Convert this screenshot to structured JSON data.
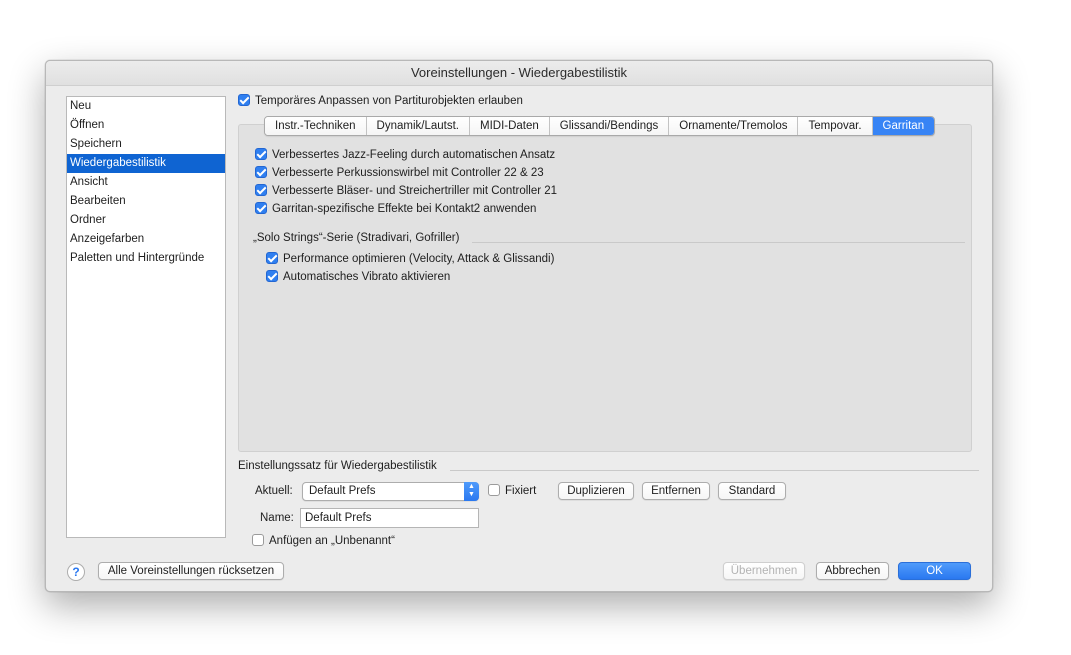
{
  "window": {
    "title": "Voreinstellungen - Wiedergabestilistik"
  },
  "sidebar": {
    "items": [
      {
        "label": "Neu",
        "selected": false
      },
      {
        "label": "Öffnen",
        "selected": false
      },
      {
        "label": "Speichern",
        "selected": false
      },
      {
        "label": "Wiedergabestilistik",
        "selected": true
      },
      {
        "label": "Ansicht",
        "selected": false
      },
      {
        "label": "Bearbeiten",
        "selected": false
      },
      {
        "label": "Ordner",
        "selected": false
      },
      {
        "label": "Anzeigefarben",
        "selected": false
      },
      {
        "label": "Paletten und Hintergründe",
        "selected": false
      }
    ]
  },
  "temp_adjust": {
    "label": "Temporäres Anpassen von Partiturobjekten erlauben",
    "checked": true
  },
  "tabs": [
    {
      "label": "Instr.-Techniken",
      "active": false
    },
    {
      "label": "Dynamik/Lautst.",
      "active": false
    },
    {
      "label": "MIDI-Daten",
      "active": false
    },
    {
      "label": "Glissandi/Bendings",
      "active": false
    },
    {
      "label": "Ornamente/Tremolos",
      "active": false
    },
    {
      "label": "Tempovar.",
      "active": false
    },
    {
      "label": "Garritan",
      "active": true
    }
  ],
  "garritan": {
    "options": [
      {
        "label": "Verbessertes Jazz-Feeling durch automatischen Ansatz",
        "checked": true
      },
      {
        "label": "Verbesserte Perkussionswirbel mit Controller 22 & 23",
        "checked": true
      },
      {
        "label": "Verbesserte Bläser- und Streichertriller mit Controller 21",
        "checked": true
      },
      {
        "label": "Garritan-spezifische Effekte bei Kontakt2 anwenden",
        "checked": true
      }
    ],
    "solo_strings_heading": "„Solo Strings“-Serie (Stradivari, Gofriller)",
    "solo_options": [
      {
        "label": "Performance optimieren (Velocity, Attack & Glissandi)",
        "checked": true
      },
      {
        "label": "Automatisches Vibrato aktivieren",
        "checked": true
      }
    ]
  },
  "preset_section": {
    "heading": "Einstellungssatz für Wiedergabestilistik",
    "current_label": "Aktuell:",
    "current_value": "Default Prefs",
    "fixed_label": "Fixiert",
    "fixed_checked": false,
    "duplicate_label": "Duplizieren",
    "remove_label": "Entfernen",
    "standard_label": "Standard",
    "name_label": "Name:",
    "name_value": "Default Prefs",
    "append_label": "Anfügen an „Unbenannt“",
    "append_checked": false
  },
  "footer": {
    "help_symbol": "?",
    "reset_all_label": "Alle Voreinstellungen rücksetzen",
    "apply_label": "Übernehmen",
    "cancel_label": "Abbrechen",
    "ok_label": "OK"
  },
  "colors": {
    "accent": "#2a78f0",
    "selection": "#0f64d2",
    "panel_bg": "#e1e1e1",
    "window_bg": "#ececec"
  }
}
